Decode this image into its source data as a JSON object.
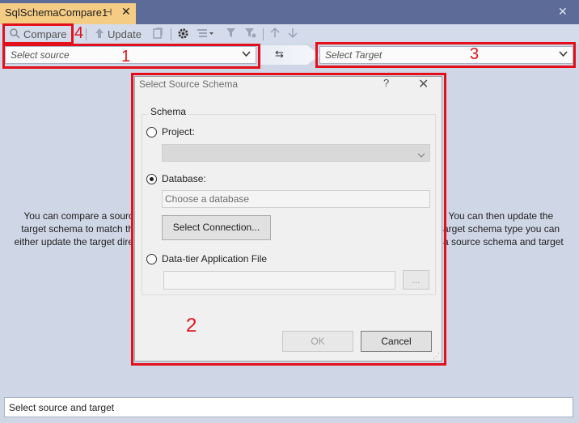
{
  "document_tab": {
    "title": "SqlSchemaCompare1",
    "pin_icon": "pin-icon",
    "close_glyph": "✕"
  },
  "toolbar": {
    "compare_label": "Compare",
    "update_label": "Update",
    "compare_icon": "compare-icon",
    "update_icon": "update-arrow-icon",
    "script_icon": "generate-script-icon",
    "settings_icon": "gear-icon",
    "group_icon": "group-results-icon",
    "filter_icon": "filter-icon",
    "clear_filter_icon": "clear-filter-icon",
    "up_icon": "arrow-up-icon",
    "down_icon": "arrow-down-icon"
  },
  "source_combo": {
    "placeholder": "Select source"
  },
  "target_combo": {
    "placeholder": "Select Target"
  },
  "swap_icon": "swap-arrows-icon",
  "annotations": {
    "n1": "1",
    "n2": "2",
    "n3": "3",
    "n4": "4",
    "color": "#e3101b"
  },
  "background_message": {
    "left_line1": "You can compare a sourc",
    "left_line2": "target schema to match th",
    "left_line3": "either update the target dire",
    "right_line1": ".  You can then update the",
    "right_line2": "arget schema type you can",
    "right_line3": "a source schema and target"
  },
  "dialog": {
    "title": "Select Source Schema",
    "help": "?",
    "close": "✕",
    "group_label": "Schema",
    "project_label": "Project:",
    "database_label": "Database:",
    "database_placeholder": "Choose a database",
    "select_connection_label": "Select Connection...",
    "dacpac_label": "Data-tier Application File",
    "browse_label": "...",
    "ok_label": "OK",
    "cancel_label": "Cancel",
    "selected_option": "Database"
  },
  "status": {
    "text": "Select source and target"
  }
}
